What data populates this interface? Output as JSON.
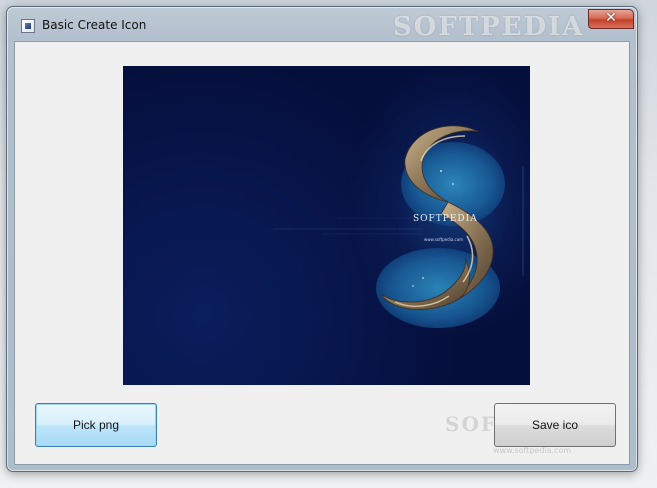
{
  "window": {
    "title": "Basic Create Icon",
    "close_glyph": "✕"
  },
  "watermark": {
    "brand": "SOFTPEDIA",
    "brand_small": "SOFTPEDIA",
    "url_small": "www.softpedia.com"
  },
  "picture": {
    "brand": "SOFTPEDIA",
    "url": "www.softpedia.com"
  },
  "buttons": {
    "pick_label": "Pick png",
    "save_label": "Save ico"
  },
  "icons": {
    "app": "app-window-icon",
    "close": "close-icon"
  },
  "colors": {
    "close_red": "#c4402b",
    "focus_blue": "#3c7fb1",
    "picture_navy": "#050f3b"
  }
}
